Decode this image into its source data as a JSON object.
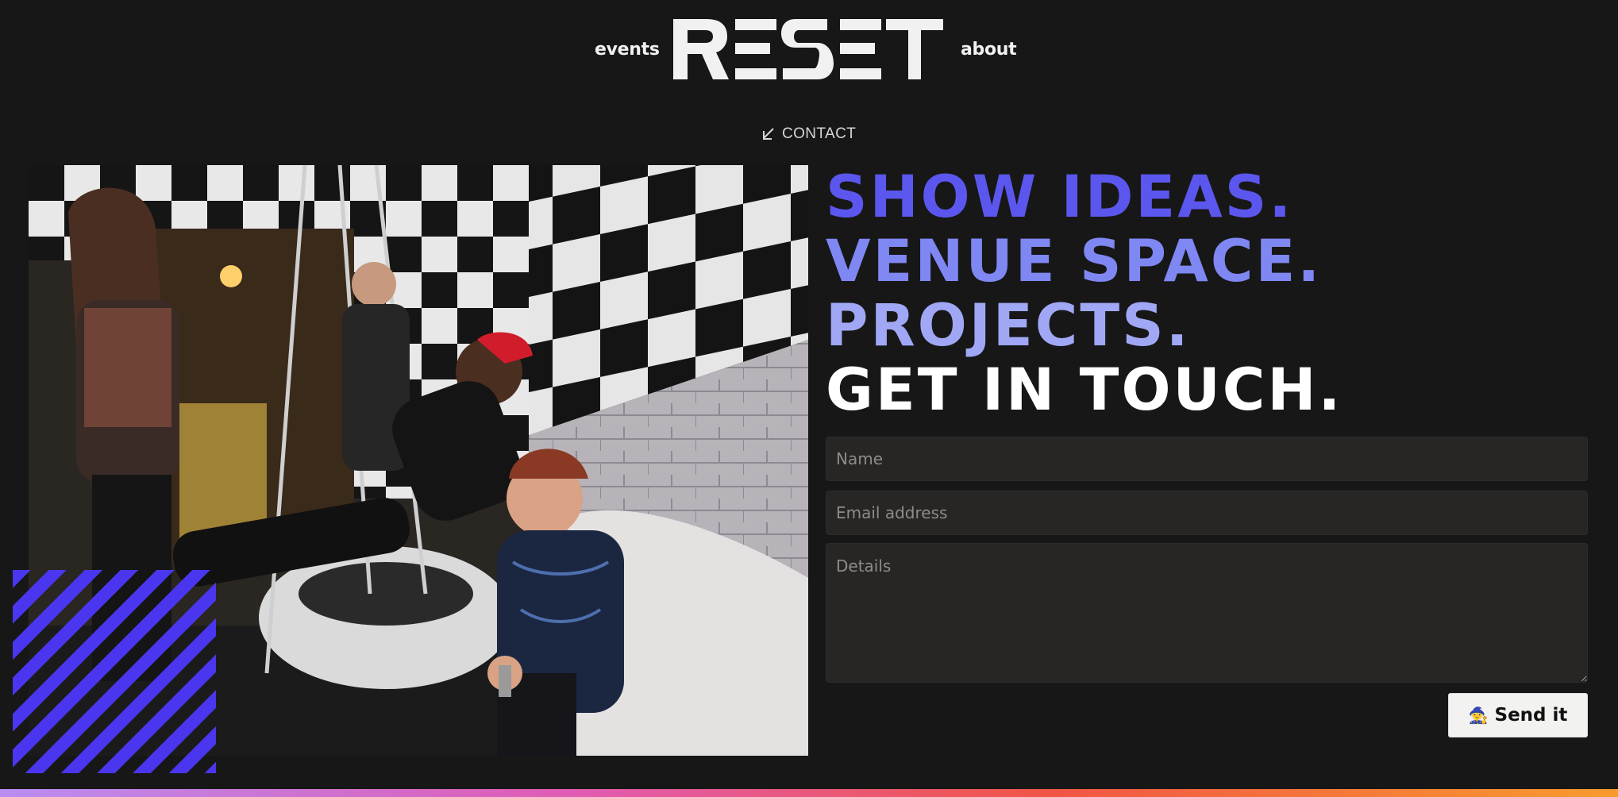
{
  "header": {
    "nav_left": "events",
    "nav_right": "about",
    "logo_text": "RESET"
  },
  "contact": {
    "label": "CONTACT",
    "icon": "arrow-down-left-icon"
  },
  "headline": {
    "lines": [
      "SHOW IDEAS.",
      "VENUE SPACE.",
      "PROJECTS.",
      "GET IN TOUCH."
    ],
    "colors": [
      "#5b57ee",
      "#7f87f3",
      "#a0a8f5",
      "#ffffff"
    ]
  },
  "form": {
    "name_placeholder": "Name",
    "email_placeholder": "Email address",
    "details_placeholder": "Details",
    "submit_emoji": "🧙",
    "submit_label": "Send it"
  },
  "colors": {
    "background": "#181718",
    "accent": "#4a36ee",
    "field_bg": "#282525"
  }
}
